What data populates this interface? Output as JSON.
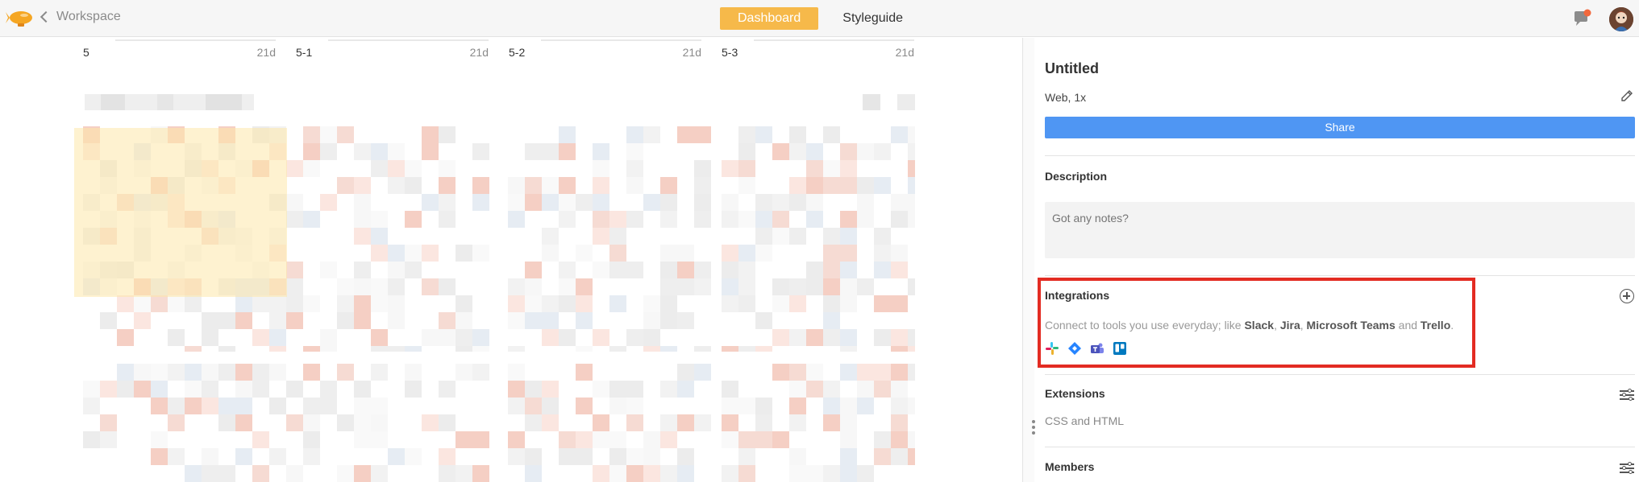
{
  "topbar": {
    "back_label": "Workspace",
    "tabs": [
      {
        "label": "Dashboard",
        "active": true
      },
      {
        "label": "Styleguide",
        "active": false
      }
    ],
    "icons": {
      "logo": "zeppelin-logo-icon",
      "notifications": "notification-icon",
      "avatar": "user-avatar"
    }
  },
  "boards": [
    {
      "name": "5",
      "age": "21d"
    },
    {
      "name": "5-1",
      "age": "21d"
    },
    {
      "name": "5-2",
      "age": "21d"
    },
    {
      "name": "5-3",
      "age": "21d"
    }
  ],
  "panel": {
    "title": "Untitled",
    "subtitle": "Web, 1x",
    "share_label": "Share",
    "description": {
      "title": "Description",
      "placeholder": "Got any notes?"
    },
    "integrations": {
      "title": "Integrations",
      "text_prefix": "Connect to tools you use everyday; like ",
      "slack": "Slack",
      "sep1": ", ",
      "jira": "Jira",
      "sep2": ", ",
      "teams": "Microsoft Teams",
      "sep3": " and ",
      "trello": "Trello",
      "suffix": ".",
      "icons": [
        "slack-icon",
        "jira-icon",
        "teams-icon",
        "trello-icon"
      ]
    },
    "extensions": {
      "title": "Extensions",
      "text": "CSS and HTML"
    },
    "members": {
      "title": "Members"
    }
  },
  "colors": {
    "accent": "#f6b94a",
    "share": "#4f96f3",
    "highlight": "#e32b22"
  }
}
